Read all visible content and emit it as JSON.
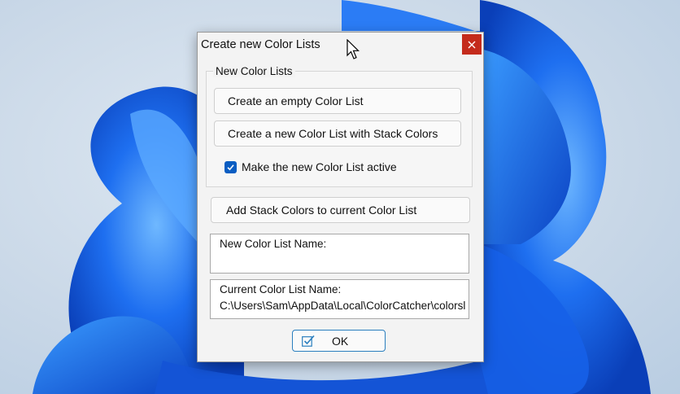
{
  "dialog": {
    "title": "Create new Color Lists",
    "close_icon": "close-icon",
    "group_label": "New Color Lists",
    "create_empty_label": "Create an empty Color List",
    "create_stack_label": "Create a new Color List with Stack Colors",
    "make_active_label": "Make the new Color List active",
    "make_active_checked": true,
    "add_stack_label": "Add Stack Colors to current Color List",
    "new_name_label": "New Color List Name:",
    "new_name_value": "",
    "current_name_label": "Current Color List Name:",
    "current_name_value": "C:\\Users\\Sam\\AppData\\Local\\ColorCatcher\\colorsl",
    "ok_label": "OK",
    "ok_icon": "checkmark-icon"
  },
  "colors": {
    "close_button": "#c42b1c",
    "checkbox_accent": "#0a5dc2",
    "ok_border": "#2a7fbf"
  }
}
